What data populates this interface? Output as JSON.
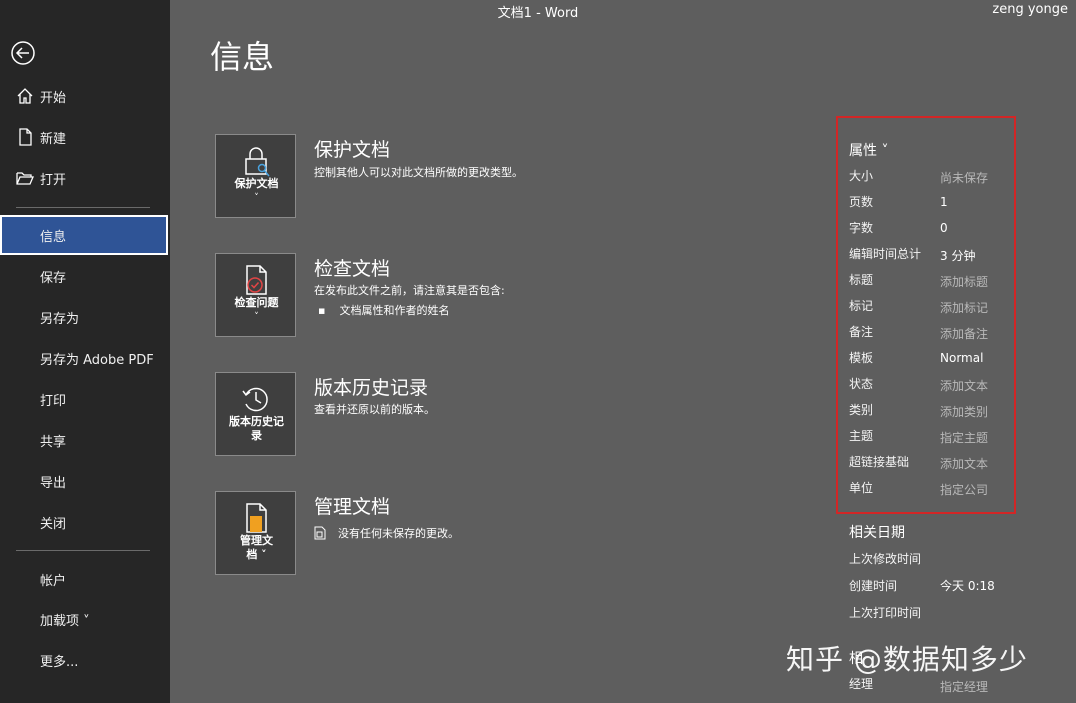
{
  "window": {
    "title": "文档1  -  Word",
    "user": "zeng yonge"
  },
  "page": {
    "title": "信息"
  },
  "nav": {
    "home": "开始",
    "new": "新建",
    "open": "打开",
    "info": "信息",
    "save": "保存",
    "save_as": "另存为",
    "save_pdf": "另存为 Adobe PDF",
    "print": "打印",
    "share": "共享",
    "export": "导出",
    "close": "关闭",
    "account": "帐户",
    "addins": "加载项 ˅",
    "more": "更多..."
  },
  "sections": {
    "protect": {
      "button": "保护文档",
      "title": "保护文档",
      "desc": "控制其他人可以对此文档所做的更改类型。"
    },
    "inspect": {
      "button": "检查问题",
      "title": "检查文档",
      "desc": "在发布此文件之前，请注意其是否包含:",
      "bullet": "文档属性和作者的姓名"
    },
    "versions": {
      "button_line1": "版本历史记",
      "button_line2": "录",
      "title": "版本历史记录",
      "desc": "查看并还原以前的版本。"
    },
    "manage": {
      "button_line1": "管理文",
      "button_line2": "档 ˅",
      "title": "管理文档",
      "desc": "没有任何未保存的更改。"
    }
  },
  "properties": {
    "heading": "属性 ˅",
    "rows": [
      {
        "key": "大小",
        "value": "尚未保存"
      },
      {
        "key": "页数",
        "value": "1"
      },
      {
        "key": "字数",
        "value": "0"
      },
      {
        "key": "编辑时间总计",
        "value": "3 分钟"
      },
      {
        "key": "标题",
        "value": "添加标题"
      },
      {
        "key": "标记",
        "value": "添加标记"
      },
      {
        "key": "备注",
        "value": "添加备注"
      },
      {
        "key": "模板",
        "value": "Normal"
      },
      {
        "key": "状态",
        "value": "添加文本"
      },
      {
        "key": "类别",
        "value": "添加类别"
      },
      {
        "key": "主题",
        "value": "指定主题"
      },
      {
        "key": "超链接基础",
        "value": "添加文本"
      },
      {
        "key": "单位",
        "value": "指定公司"
      }
    ]
  },
  "dates": {
    "heading": "相关日期",
    "rows": [
      {
        "key": "上次修改时间",
        "value": ""
      },
      {
        "key": "创建时间",
        "value": "今天 0:18"
      },
      {
        "key": "上次打印时间",
        "value": ""
      }
    ]
  },
  "people": {
    "related_partial": "相",
    "manager_key": "经理",
    "manager_value": "指定经理"
  },
  "watermark": "知乎 @数据知多少",
  "colors": {
    "active_nav": "#2f5496",
    "highlight_border": "#d32626",
    "background": "#5e5e5e",
    "sidebar": "#262626"
  }
}
